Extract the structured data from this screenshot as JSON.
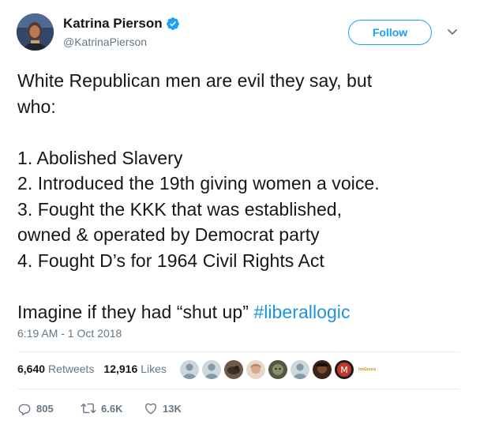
{
  "author": {
    "name": "Katrina Pierson",
    "handle": "@KatrinaPierson",
    "verified": true
  },
  "follow_label": "Follow",
  "tweet": {
    "lines": [
      "White Republican men are evil they say, but",
      "who:",
      "",
      "1. Abolished Slavery",
      "2. Introduced the 19th giving women a voice.",
      "3. Fought the KKK that was established,",
      "owned & operated by Democrat party",
      "4. Fought D’s for 1964 Civil Rights Act",
      ""
    ],
    "last_line_text": "Imagine if they had “shut up” ",
    "hashtag": "#liberallogic",
    "timestamp": "6:19 AM - 1 Oct 2018"
  },
  "stats": {
    "retweets_count": "6,640",
    "retweets_label": "Retweets",
    "likes_count": "12,916",
    "likes_label": "Likes"
  },
  "likers_logo_text": "lexGnoxy",
  "actions": {
    "replies": "805",
    "retweets": "6.6K",
    "likes": "13K"
  },
  "colors": {
    "accent": "#1da1f2",
    "hashtag": "#1b95e0",
    "muted": "#657786",
    "text": "#14171a",
    "divider": "#e6ecf0"
  }
}
